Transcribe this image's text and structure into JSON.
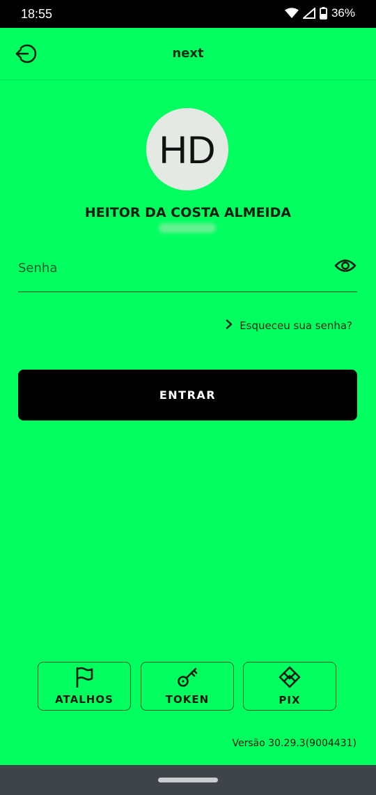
{
  "status_bar": {
    "time": "18:55",
    "battery": "36%",
    "icons": [
      "wifi-icon",
      "signal-icon",
      "battery-icon"
    ]
  },
  "app_bar": {
    "title": "next",
    "back_icon": "logout-icon"
  },
  "profile": {
    "initials": "HD",
    "name": "HEITOR DA COSTA ALMEIDA"
  },
  "password": {
    "placeholder": "Senha",
    "value": "",
    "visibility_icon": "eye-icon"
  },
  "forgot_password": {
    "label": "Esqueceu sua senha?",
    "icon": "chevron-right-icon"
  },
  "login": {
    "button_label": "ENTRAR"
  },
  "shortcuts": [
    {
      "label": "ATALHOS",
      "icon": "flag-icon"
    },
    {
      "label": "TOKEN",
      "icon": "key-icon"
    },
    {
      "label": "PIX",
      "icon": "pix-icon"
    }
  ],
  "footer": {
    "version": "Versão 30.29.3(9004431)"
  },
  "colors": {
    "background": "#00FF5F",
    "button": "#000000",
    "avatar": "#E4E9E4"
  }
}
